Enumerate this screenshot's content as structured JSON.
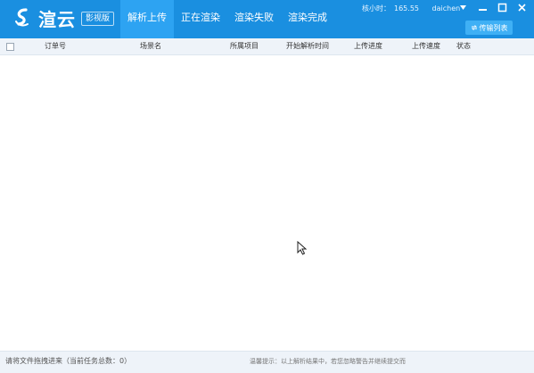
{
  "app": {
    "logo_text": "渲云",
    "edition": "影视版"
  },
  "tabs": [
    {
      "label": "解析上传",
      "active": true
    },
    {
      "label": "正在渲染",
      "active": false
    },
    {
      "label": "渲染失败",
      "active": false
    },
    {
      "label": "渲染完成",
      "active": false
    }
  ],
  "account": {
    "balance_label": "核小时：",
    "balance_value": "165.55",
    "username": "daichen"
  },
  "toolbar": {
    "transfer_list_label": "传输列表"
  },
  "table": {
    "columns": [
      "订单号",
      "场景名",
      "所属项目",
      "开始解析时间",
      "上传进度",
      "上传速度",
      "状态"
    ],
    "rows": []
  },
  "status": {
    "left_text": "请将文件拖拽进来（当前任务总数：0）",
    "right_text": "温馨提示：以上解析结果中，若您忽略警告并继续提交而"
  },
  "colors": {
    "titlebar": "#1a8fe0",
    "active_tab": "#2da3f2",
    "header_bg": "#eef3f9"
  }
}
